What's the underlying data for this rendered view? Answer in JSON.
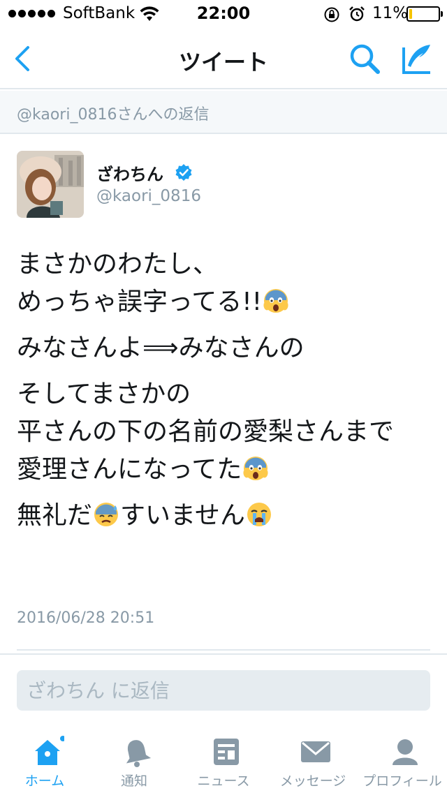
{
  "status_bar": {
    "carrier": "SoftBank",
    "time": "22:00",
    "battery_percent": "11%",
    "battery_level": 0.11,
    "signal_bars": 5
  },
  "nav": {
    "title": "ツイート",
    "back_icon": "chevron-left-icon",
    "search_icon": "search-icon",
    "compose_icon": "compose-tweet-icon"
  },
  "reply_banner": "@kaori_0816さんへの返信",
  "tweet": {
    "display_name": "ざわちん",
    "verified": true,
    "handle": "@kaori_0816",
    "paragraphs": [
      {
        "text": "まさかのわたし、\nめっちゃ誤字ってる!!",
        "emoji": "scream-emoji"
      },
      {
        "text": "みなさんよ⟹みなさんの",
        "emoji": ""
      },
      {
        "text": "そしてまさかの\n平さんの下の名前の愛梨さんまで\n愛理さんになってた",
        "emoji": "scream-emoji"
      },
      {
        "text": "無礼だ",
        "emoji": "anxious-sweat-emoji",
        "text2": "すいません",
        "emoji2": "crying-emoji"
      }
    ],
    "timestamp": "2016/06/28 20:51"
  },
  "reply_input": {
    "placeholder": "ざわちん に返信",
    "value": ""
  },
  "tabs": [
    {
      "label": "ホーム",
      "icon": "home-icon",
      "active": true,
      "badge": true
    },
    {
      "label": "通知",
      "icon": "bell-icon",
      "active": false
    },
    {
      "label": "ニュース",
      "icon": "news-icon",
      "active": false
    },
    {
      "label": "メッセージ",
      "icon": "envelope-icon",
      "active": false
    },
    {
      "label": "プロフィール",
      "icon": "person-icon",
      "active": false
    }
  ],
  "colors": {
    "accent": "#1da1f2",
    "text": "#14171a",
    "secondary": "#8899a6",
    "battery_low": "#f5c400"
  }
}
